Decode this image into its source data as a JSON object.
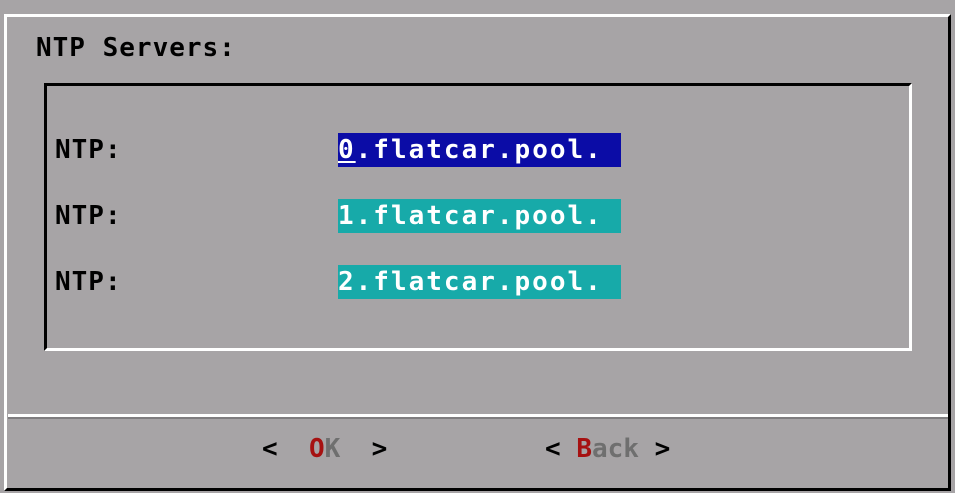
{
  "dialog": {
    "title": "NTP Servers:"
  },
  "fields": [
    {
      "label": "NTP:",
      "value_first": "0",
      "value_rest": ".flatcar.pool."
    },
    {
      "label": "NTP:",
      "value": "1.flatcar.pool."
    },
    {
      "label": "NTP:",
      "value": "2.flatcar.pool."
    }
  ],
  "buttons": {
    "ok": {
      "left": "<",
      "hotkey": "O",
      "rest": "K",
      "right": ">"
    },
    "back": {
      "left": "<",
      "hotkey": "B",
      "rest": "ack",
      "right": ">"
    }
  },
  "colors": {
    "background": "#a7a4a6",
    "active_field": "#0b0ca6",
    "inactive_field": "#17aaa9",
    "hotkey": "#a61111",
    "button_text": "#6f6f6f"
  }
}
